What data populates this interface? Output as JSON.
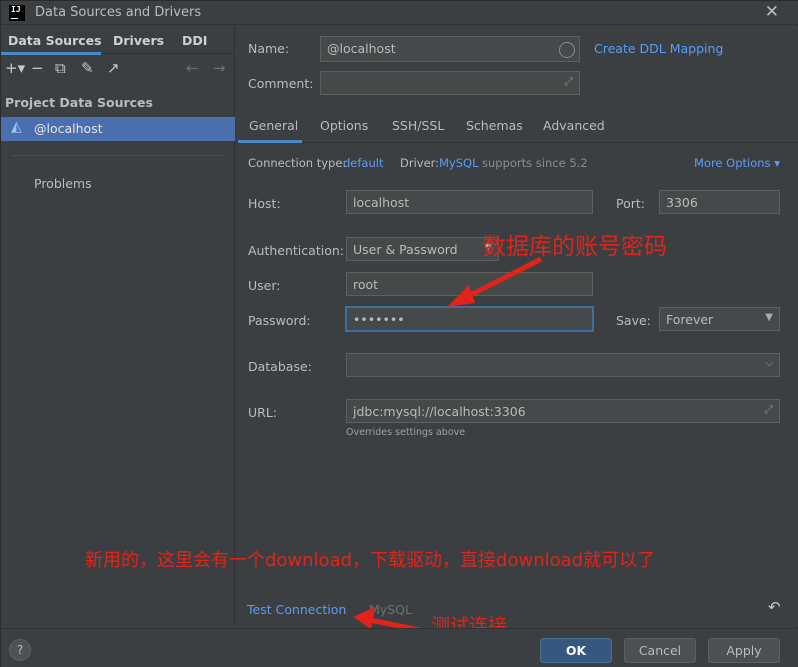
{
  "window": {
    "title": "Data Sources and Drivers",
    "logo": "IJ"
  },
  "left": {
    "tabs": [
      "Data Sources",
      "Drivers",
      "DDI"
    ],
    "section_title": "Project Data Sources",
    "datasource": "@localhost",
    "problems": "Problems",
    "toolbar_icons": [
      "add-icon",
      "remove-icon",
      "duplicate-icon",
      "wrench-icon",
      "jump-icon",
      "back-icon",
      "forward-icon"
    ]
  },
  "form": {
    "name_label": "Name:",
    "name_value": "@localhost",
    "create_ddl": "Create DDL Mapping",
    "comment_label": "Comment:",
    "comment_value": "",
    "tabs": [
      "General",
      "Options",
      "SSH/SSL",
      "Schemas",
      "Advanced"
    ],
    "conn_type_label": "Connection type:",
    "conn_type_value": "default",
    "driver_label": "Driver:",
    "driver_value": "MySQL",
    "driver_note": "supports since 5.2",
    "more_options": "More Options",
    "host_label": "Host:",
    "host_value": "localhost",
    "port_label": "Port:",
    "port_value": "3306",
    "auth_label": "Authentication:",
    "auth_value": "User & Password",
    "user_label": "User:",
    "user_value": "root",
    "password_label": "Password:",
    "password_value": "•••••••",
    "save_label": "Save:",
    "save_value": "Forever",
    "database_label": "Database:",
    "database_value": "",
    "url_label": "URL:",
    "url_value": "jdbc:mysql://localhost:3306",
    "url_note": "Overrides settings above"
  },
  "bottom": {
    "test_connection": "Test Connection",
    "driver_tag": "MySQL"
  },
  "annotations": {
    "account": "数据库的账号密码",
    "download": "新用的，这里会有一个download，下载驱动，直接download就可以了",
    "test": "测试连接"
  },
  "footer": {
    "help": "?",
    "ok": "OK",
    "cancel": "Cancel",
    "apply": "Apply"
  },
  "colors": {
    "accent": "#589df6",
    "selection": "#4b6eaf",
    "annotation": "#e2231a",
    "primary_button": "#365880"
  }
}
